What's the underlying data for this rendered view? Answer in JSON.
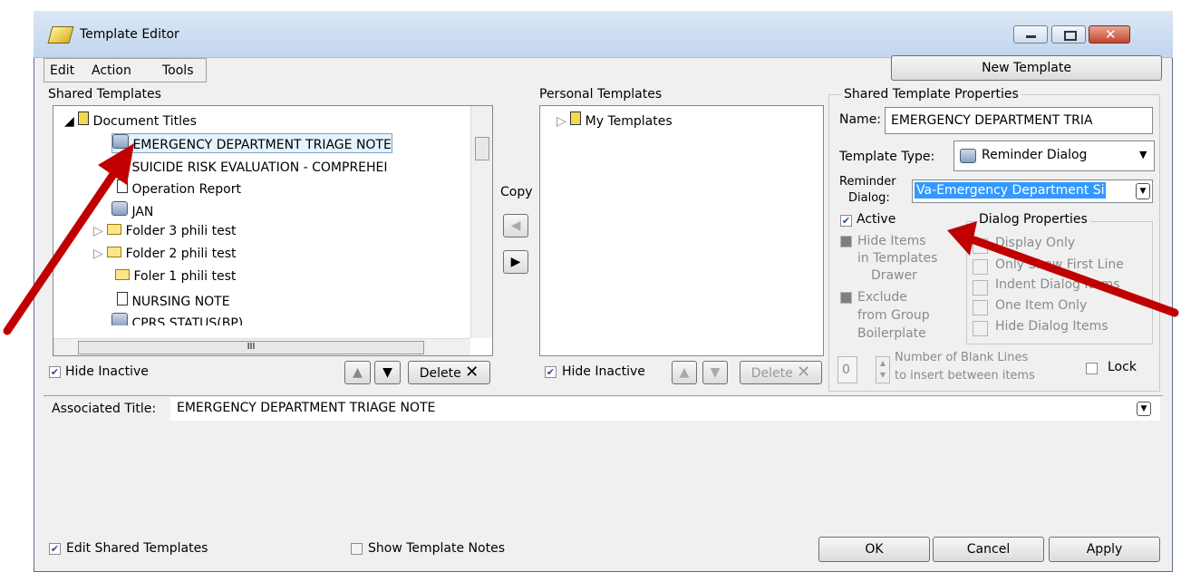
{
  "window": {
    "title": "Template Editor"
  },
  "menu": {
    "edit": "Edit",
    "action": "Action",
    "tools": "Tools"
  },
  "toolbar": {
    "new_template": "New Template"
  },
  "shared": {
    "heading": "Shared Templates",
    "items": [
      {
        "label": "Document Titles",
        "icon": "document-titles-icon"
      },
      {
        "label": "EMERGENCY DEPARTMENT TRIAGE NOTE",
        "icon": "reminder-dialog-icon"
      },
      {
        "label": "SUICIDE RISK EVALUATION - COMPREHEI",
        "icon": "reminder-dialog-icon"
      },
      {
        "label": "Operation Report",
        "icon": "document-icon"
      },
      {
        "label": "JAN",
        "icon": "reminder-dialog-icon"
      },
      {
        "label": "Folder 3 phili test",
        "icon": "folder-icon"
      },
      {
        "label": "Folder 2 phili test",
        "icon": "folder-icon"
      },
      {
        "label": "Foler 1 phili test",
        "icon": "folder-icon"
      },
      {
        "label": "NURSING NOTE",
        "icon": "document-icon"
      },
      {
        "label": "CPRS STATUS(BP)",
        "icon": "reminder-dialog-icon"
      }
    ],
    "hscroll_grip": "III",
    "hide_inactive": "Hide Inactive",
    "delete": "Delete"
  },
  "copy_label": "Copy",
  "personal": {
    "heading": "Personal Templates",
    "items": [
      {
        "label": "My Templates"
      }
    ],
    "hide_inactive": "Hide Inactive",
    "delete": "Delete"
  },
  "props": {
    "heading": "Shared Template Properties",
    "name_label": "Name:",
    "name_value": "EMERGENCY DEPARTMENT TRIA",
    "type_label": "Template Type:",
    "type_value": "Reminder Dialog",
    "reminder_label_1": "Reminder",
    "reminder_label_2": "Dialog:",
    "reminder_value": "Va-Emergency Department Si",
    "active": "Active",
    "hide_items_1": "Hide Items",
    "hide_items_2": "in Templates",
    "hide_items_3": "Drawer",
    "exclude_1": "Exclude",
    "exclude_2": "from Group",
    "exclude_3": "Boilerplate",
    "dialog_props": {
      "heading": "Dialog Properties",
      "display_only": "Display Only",
      "only_first_line": "Only Show First Line",
      "indent_items": "Indent Dialog Items",
      "one_item_only": "One Item Only",
      "hide_items": "Hide Dialog Items"
    },
    "blank_lines_value": "0",
    "blank_lines_label_1": "Number of Blank Lines",
    "blank_lines_label_2": "to insert between items",
    "lock": "Lock"
  },
  "associated": {
    "label": "Associated Title:",
    "value": "EMERGENCY DEPARTMENT TRIAGE NOTE"
  },
  "footer": {
    "edit_shared": "Edit Shared Templates",
    "show_notes": "Show Template Notes",
    "ok": "OK",
    "cancel": "Cancel",
    "apply": "Apply"
  },
  "colors": {
    "annotation_arrow": "#c00000",
    "selection": "#3399ff"
  }
}
